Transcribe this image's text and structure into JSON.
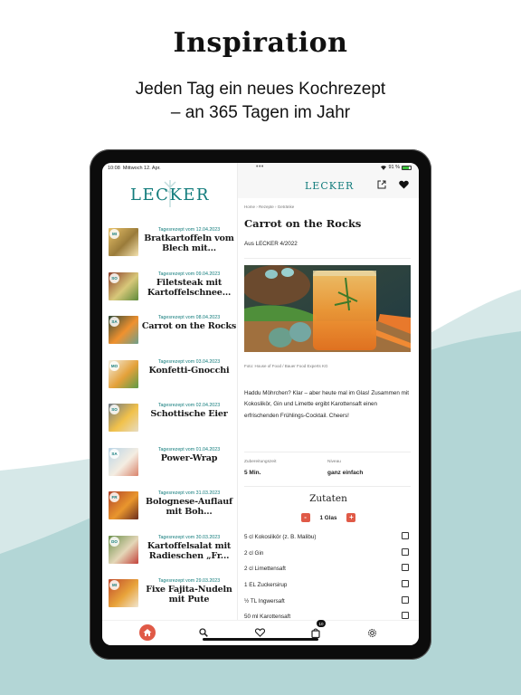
{
  "hero": {
    "title": "Inspiration",
    "subtitle_line1": "Jeden Tag ein neues Kochrezept",
    "subtitle_line2": "– an 365 Tagen im Jahr"
  },
  "colors": {
    "brand_teal": "#127c7c",
    "accent_red": "#e05a47",
    "wave_light": "#d6e8e8",
    "wave_dark": "#b3d6d6"
  },
  "status_bar": {
    "time": "10:08",
    "date": "Mittwoch 12. Apr.",
    "dots": "•••",
    "battery": "91 %"
  },
  "sidebar": {
    "logo": "LECKER",
    "items": [
      {
        "day": "MI",
        "date": "Tagesrezept vom 12.04.2023",
        "title": "Bratkartoffeln vom Blech mit..."
      },
      {
        "day": "SO",
        "date": "Tagesrezept vom 09.04.2023",
        "title": "Filetsteak mit Kartoffelschnee..."
      },
      {
        "day": "SA",
        "date": "Tagesrezept vom 08.04.2023",
        "title": "Carrot on the Rocks"
      },
      {
        "day": "MO",
        "date": "Tagesrezept vom 03.04.2023",
        "title": "Konfetti-Gnocchi"
      },
      {
        "day": "SO",
        "date": "Tagesrezept vom 02.04.2023",
        "title": "Schottische Eier"
      },
      {
        "day": "SA",
        "date": "Tagesrezept vom 01.04.2023",
        "title": "Power-Wrap"
      },
      {
        "day": "FR",
        "date": "Tagesrezept vom 31.03.2023",
        "title": "Bolognese-Auflauf mit Boh..."
      },
      {
        "day": "DO",
        "date": "Tagesrezept vom 30.03.2023",
        "title": "Kartoffelsalat mit Radieschen „Fr..."
      },
      {
        "day": "MI",
        "date": "Tagesrezept vom 29.03.2023",
        "title": "Fixe Fajita-Nudeln mit Pute"
      }
    ]
  },
  "detail": {
    "header_logo": "LECKER",
    "breadcrumb": "Home › Rezepte › Getränke",
    "title": "Carrot on the Rocks",
    "source": "Aus LECKER 4/2022",
    "photo_credit": "Foto: House of Food / Bauer Food Experts KG",
    "description": "Haddu Möhrchen? Klar – aber heute mal im Glas! Zusammen mit Kokoslikör, Gin und Limette ergibt Karottensaft einen erfrischenden Frühlings-Cocktail. Cheers!",
    "prep_label": "Zubereitungszeit",
    "prep_value": "5 Min.",
    "level_label": "Niveau",
    "level_value": "ganz einfach",
    "ingredients_title": "Zutaten",
    "minus_label": "-",
    "plus_label": "+",
    "servings": "1 Glas",
    "ingredients": [
      "5 cl Kokoslikör (z. B. Malibu)",
      "2 cl Gin",
      "2 cl Limettensaft",
      "1 EL Zuckersirup",
      "½ TL Ingwersaft",
      "50 ml Karottensaft"
    ]
  },
  "tabbar": {
    "items": [
      "home",
      "search",
      "favorites",
      "cart",
      "settings"
    ],
    "cart_count": "10"
  }
}
